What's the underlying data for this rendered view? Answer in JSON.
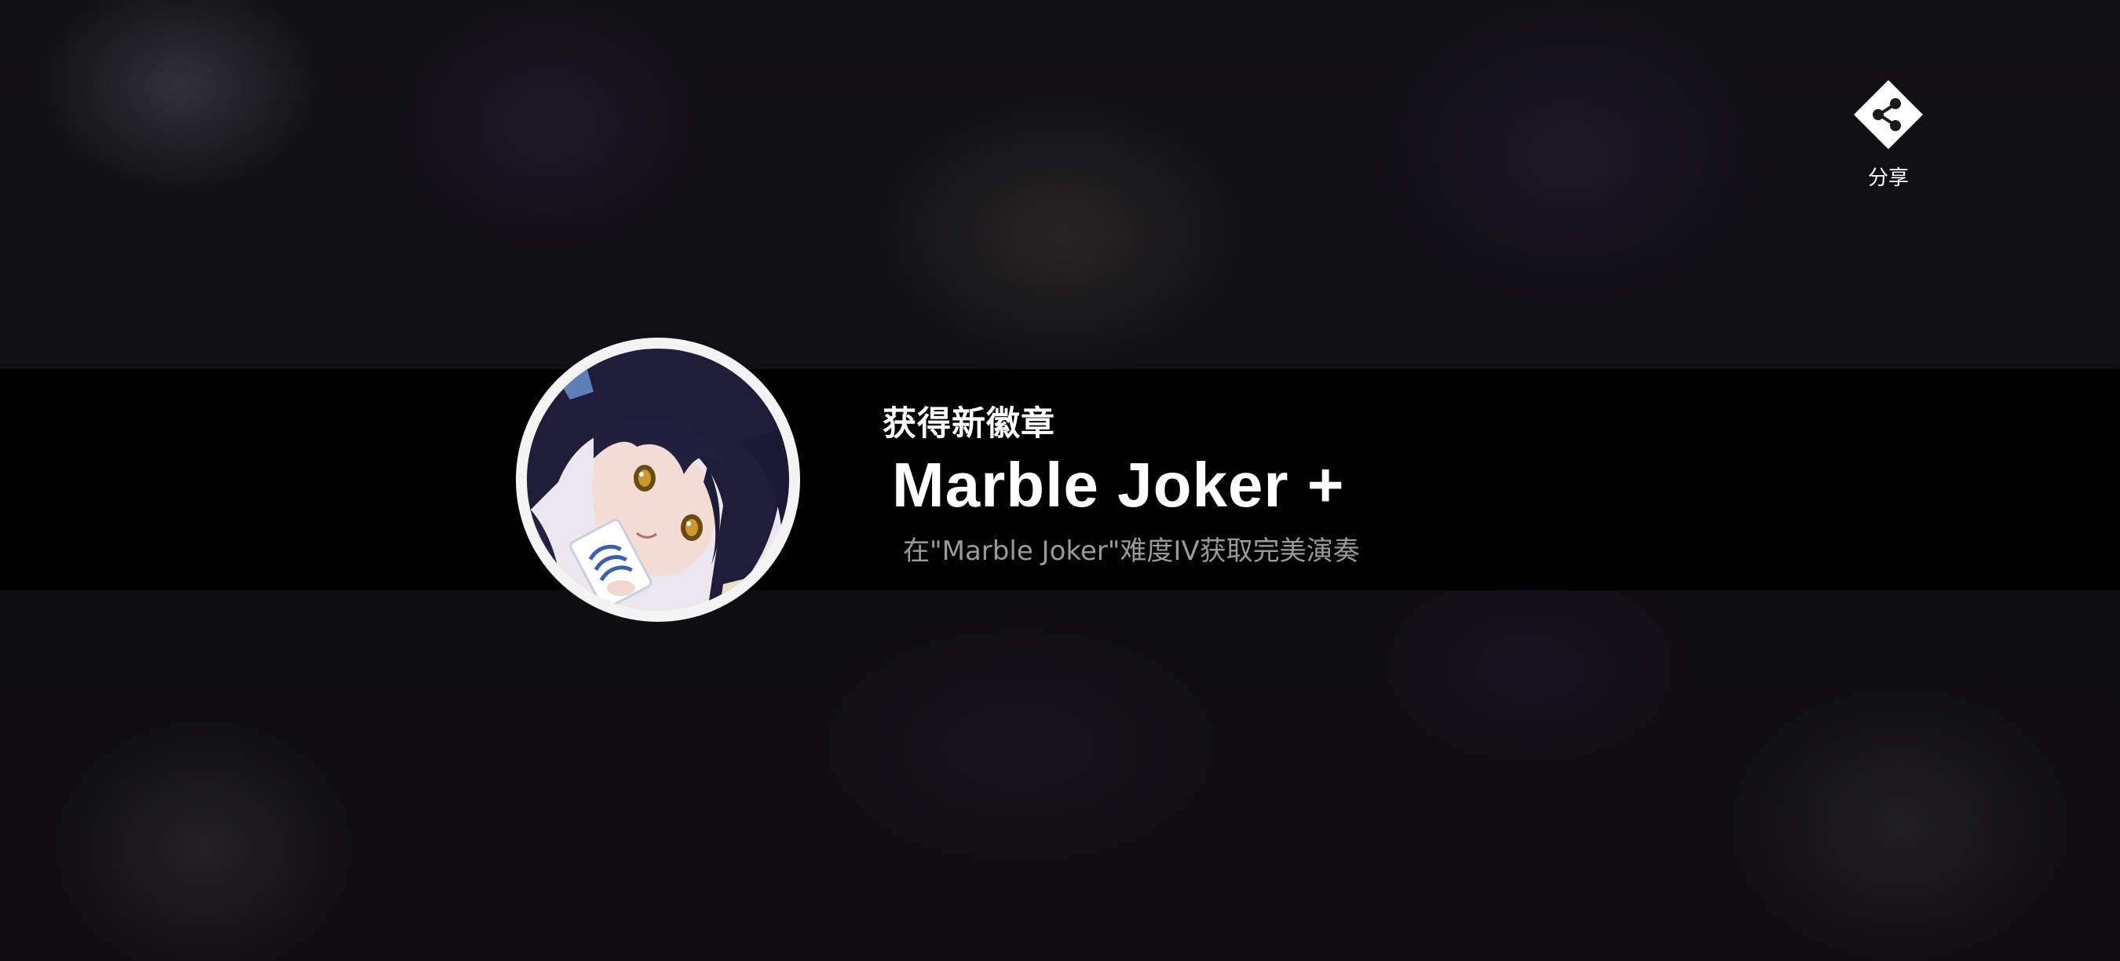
{
  "share": {
    "icon": "share-icon",
    "label": "分享"
  },
  "achievement": {
    "header": "获得新徽章",
    "badge_name": "Marble Joker +",
    "description": "在\"Marble Joker\"难度IV获取完美演奏"
  },
  "colors": {
    "background": "#0e0d10",
    "banner": "#000000",
    "badge_ring": "#f4f4f4",
    "title_text": "#ffffff",
    "description_text": "#9a9a9a"
  }
}
